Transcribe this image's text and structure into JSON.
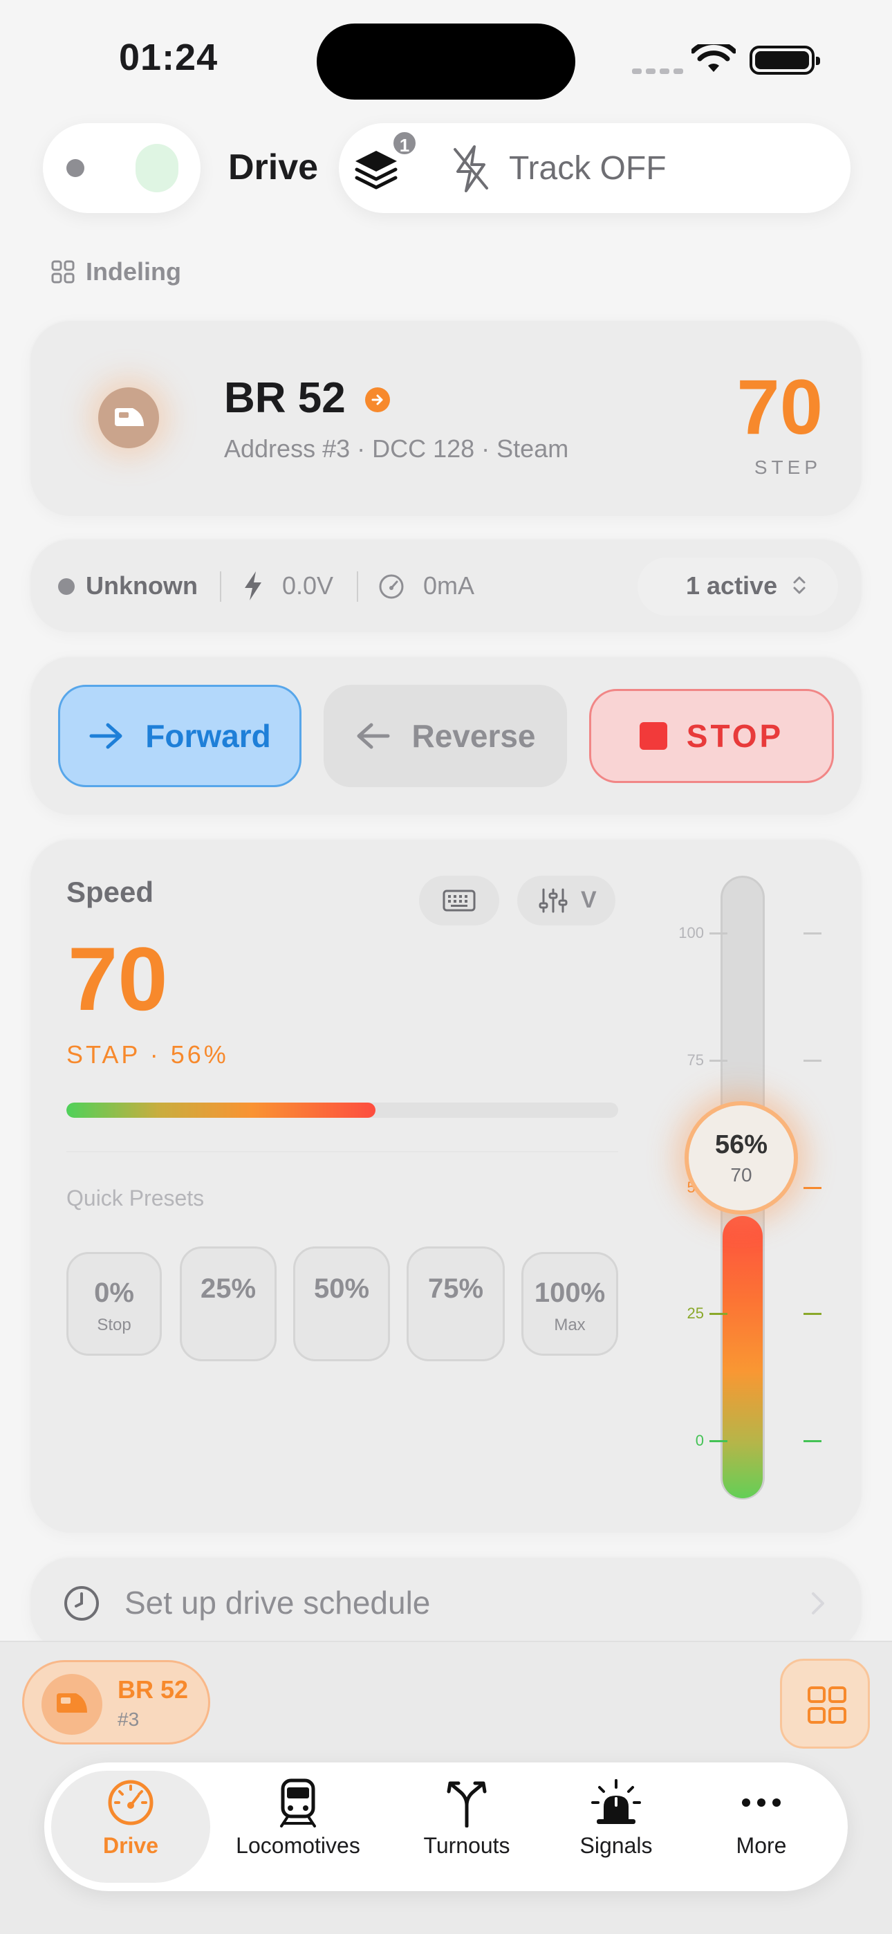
{
  "status_bar": {
    "time": "01:24"
  },
  "header": {
    "title": "Drive",
    "layers_badge": "1",
    "track_status": "Track OFF"
  },
  "layout_link": {
    "label": "Indeling"
  },
  "loco": {
    "name": "BR 52",
    "subtitle": "Address #3 · DCC 128 · Steam",
    "step_value": "70",
    "step_label": "STEP"
  },
  "status": {
    "connection": "Unknown",
    "voltage": "0.0V",
    "current": "0mA",
    "active_selector": "1 active"
  },
  "direction": {
    "forward_label": "Forward",
    "reverse_label": "Reverse",
    "stop_label": "STOP",
    "selected": "forward"
  },
  "speed": {
    "title": "Speed",
    "value": "70",
    "sub": "STAP  ·  56%",
    "percent": 56,
    "tune_label": "V",
    "presets_label": "Quick Presets",
    "presets": [
      {
        "value": "0%",
        "label": "Stop"
      },
      {
        "value": "25%",
        "label": ""
      },
      {
        "value": "50%",
        "label": ""
      },
      {
        "value": "75%",
        "label": ""
      },
      {
        "value": "100%",
        "label": "Max"
      }
    ],
    "slider_ticks": [
      "100",
      "75",
      "50",
      "25",
      "0"
    ],
    "knob_percent": "56%",
    "knob_step": "70"
  },
  "schedule": {
    "label": "Set up drive schedule"
  },
  "active_loco": {
    "name": "BR 52",
    "address": "#3"
  },
  "tabs": [
    {
      "label": "Drive",
      "icon": "speedometer-icon",
      "active": true
    },
    {
      "label": "Locomotives",
      "icon": "train-icon",
      "active": false
    },
    {
      "label": "Turnouts",
      "icon": "turnout-split-icon",
      "active": false
    },
    {
      "label": "Signals",
      "icon": "siren-icon",
      "active": false
    },
    {
      "label": "More",
      "icon": "ellipsis-icon",
      "active": false
    }
  ],
  "colors": {
    "accent": "#f7892c",
    "forward": "#1e7fd8",
    "stop": "#e83a3a"
  }
}
